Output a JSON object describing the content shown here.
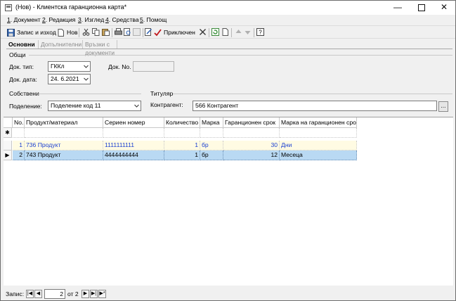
{
  "window": {
    "title": "(Нов) - Клиентска гаранционна карта*",
    "controls": [
      "minimize-icon",
      "maximize-icon",
      "close-icon"
    ]
  },
  "menu": [
    {
      "key": "1",
      "label": ". Документ"
    },
    {
      "key": "2",
      "label": ". Редакция"
    },
    {
      "key": "3",
      "label": ". Изглед"
    },
    {
      "key": "4",
      "label": ". Средства"
    },
    {
      "key": "5",
      "label": ". Помощ"
    }
  ],
  "toolbar": {
    "save_exit": "Запис и изход",
    "new": "Нов",
    "close_doc": "Приключен"
  },
  "tabs": [
    "Основни",
    "Допълнителни",
    "Връзки с документи"
  ],
  "general": {
    "legend": "Общи",
    "doc_type_label": "Док. тип:",
    "doc_type_value": "ГККл",
    "doc_no_label": "Док. No.",
    "doc_no_value": "",
    "doc_date_label": "Док. дата:",
    "doc_date_value": "24.  6.2021"
  },
  "owners": {
    "legend": "Собствени",
    "division_label": "Поделение:",
    "division_value": "Поделение код 11"
  },
  "holder": {
    "legend": "Титуляр",
    "partner_label": "Контрагент:",
    "partner_value": "566 Контрагент",
    "browse": "..."
  },
  "grid": {
    "columns": [
      "No.",
      "Продукт/материал",
      "Сериен номер",
      "Количество",
      "Марка",
      "Гаранционен срок",
      "Марка на гаранционен срок"
    ],
    "new_row_marker": "✱",
    "rows": [
      {
        "no": "1",
        "product": "736 Продукт",
        "serial": "1111111111",
        "qty": "1",
        "brand": "бр",
        "period": "30",
        "period_unit": "Дни"
      },
      {
        "no": "2",
        "product": "743 Продукт",
        "serial": "4444444444",
        "qty": "1",
        "brand": "бр",
        "period": "12",
        "period_unit": "Месеца"
      }
    ]
  },
  "status": {
    "record_label": "Запис:",
    "current": "2",
    "of_label": "от 2"
  }
}
